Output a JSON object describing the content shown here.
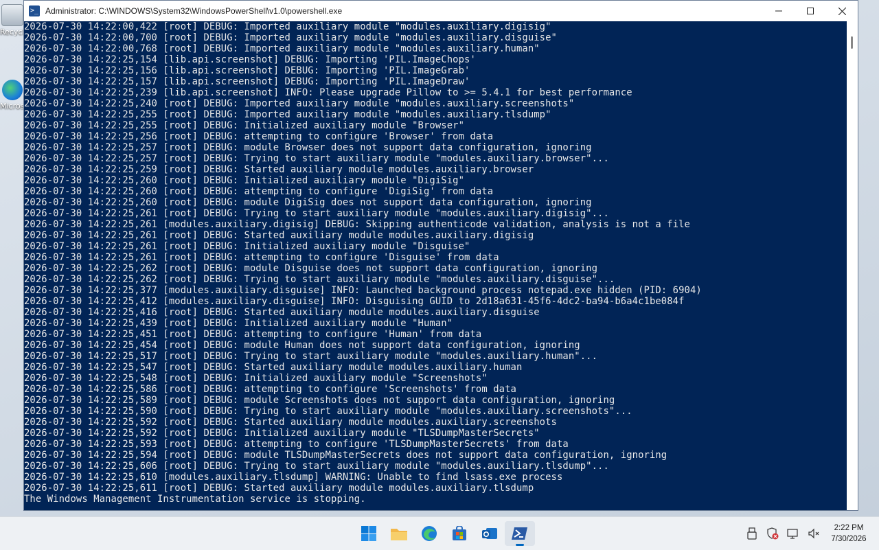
{
  "desktop": {
    "icons": [
      {
        "label": "Recycle Bin"
      },
      {
        "label": "Microsoft Edge"
      }
    ]
  },
  "window": {
    "title": "Administrator: C:\\WINDOWS\\System32\\WindowsPowerShell\\v1.0\\powershell.exe",
    "colors": {
      "console_bg": "#012456",
      "console_fg": "#e8e8e8"
    }
  },
  "console": {
    "lines": [
      "2026-07-30 14:22:00,422 [root] DEBUG: Imported auxiliary module \"modules.auxiliary.digisig\"",
      "2026-07-30 14:22:00,700 [root] DEBUG: Imported auxiliary module \"modules.auxiliary.disguise\"",
      "2026-07-30 14:22:00,768 [root] DEBUG: Imported auxiliary module \"modules.auxiliary.human\"",
      "2026-07-30 14:22:25,154 [lib.api.screenshot] DEBUG: Importing 'PIL.ImageChops'",
      "2026-07-30 14:22:25,156 [lib.api.screenshot] DEBUG: Importing 'PIL.ImageGrab'",
      "2026-07-30 14:22:25,157 [lib.api.screenshot] DEBUG: Importing 'PIL.ImageDraw'",
      "2026-07-30 14:22:25,239 [lib.api.screenshot] INFO: Please upgrade Pillow to >= 5.4.1 for best performance",
      "2026-07-30 14:22:25,240 [root] DEBUG: Imported auxiliary module \"modules.auxiliary.screenshots\"",
      "2026-07-30 14:22:25,255 [root] DEBUG: Imported auxiliary module \"modules.auxiliary.tlsdump\"",
      "2026-07-30 14:22:25,255 [root] DEBUG: Initialized auxiliary module \"Browser\"",
      "2026-07-30 14:22:25,256 [root] DEBUG: attempting to configure 'Browser' from data",
      "2026-07-30 14:22:25,257 [root] DEBUG: module Browser does not support data configuration, ignoring",
      "2026-07-30 14:22:25,257 [root] DEBUG: Trying to start auxiliary module \"modules.auxiliary.browser\"...",
      "2026-07-30 14:22:25,259 [root] DEBUG: Started auxiliary module modules.auxiliary.browser",
      "2026-07-30 14:22:25,260 [root] DEBUG: Initialized auxiliary module \"DigiSig\"",
      "2026-07-30 14:22:25,260 [root] DEBUG: attempting to configure 'DigiSig' from data",
      "2026-07-30 14:22:25,260 [root] DEBUG: module DigiSig does not support data configuration, ignoring",
      "2026-07-30 14:22:25,261 [root] DEBUG: Trying to start auxiliary module \"modules.auxiliary.digisig\"...",
      "2026-07-30 14:22:25,261 [modules.auxiliary.digisig] DEBUG: Skipping authenticode validation, analysis is not a file",
      "2026-07-30 14:22:25,261 [root] DEBUG: Started auxiliary module modules.auxiliary.digisig",
      "2026-07-30 14:22:25,261 [root] DEBUG: Initialized auxiliary module \"Disguise\"",
      "2026-07-30 14:22:25,261 [root] DEBUG: attempting to configure 'Disguise' from data",
      "2026-07-30 14:22:25,262 [root] DEBUG: module Disguise does not support data configuration, ignoring",
      "2026-07-30 14:22:25,262 [root] DEBUG: Trying to start auxiliary module \"modules.auxiliary.disguise\"...",
      "2026-07-30 14:22:25,377 [modules.auxiliary.disguise] INFO: Launched background process notepad.exe hidden (PID: 6904)",
      "2026-07-30 14:22:25,412 [modules.auxiliary.disguise] INFO: Disguising GUID to 2d18a631-45f6-4dc2-ba94-b6a4c1be084f",
      "2026-07-30 14:22:25,416 [root] DEBUG: Started auxiliary module modules.auxiliary.disguise",
      "2026-07-30 14:22:25,439 [root] DEBUG: Initialized auxiliary module \"Human\"",
      "2026-07-30 14:22:25,451 [root] DEBUG: attempting to configure 'Human' from data",
      "2026-07-30 14:22:25,454 [root] DEBUG: module Human does not support data configuration, ignoring",
      "2026-07-30 14:22:25,517 [root] DEBUG: Trying to start auxiliary module \"modules.auxiliary.human\"...",
      "2026-07-30 14:22:25,547 [root] DEBUG: Started auxiliary module modules.auxiliary.human",
      "2026-07-30 14:22:25,548 [root] DEBUG: Initialized auxiliary module \"Screenshots\"",
      "2026-07-30 14:22:25,586 [root] DEBUG: attempting to configure 'Screenshots' from data",
      "2026-07-30 14:22:25,589 [root] DEBUG: module Screenshots does not support data configuration, ignoring",
      "2026-07-30 14:22:25,590 [root] DEBUG: Trying to start auxiliary module \"modules.auxiliary.screenshots\"...",
      "2026-07-30 14:22:25,592 [root] DEBUG: Started auxiliary module modules.auxiliary.screenshots",
      "2026-07-30 14:22:25,592 [root] DEBUG: Initialized auxiliary module \"TLSDumpMasterSecrets\"",
      "2026-07-30 14:22:25,593 [root] DEBUG: attempting to configure 'TLSDumpMasterSecrets' from data",
      "2026-07-30 14:22:25,594 [root] DEBUG: module TLSDumpMasterSecrets does not support data configuration, ignoring",
      "2026-07-30 14:22:25,606 [root] DEBUG: Trying to start auxiliary module \"modules.auxiliary.tlsdump\"...",
      "2026-07-30 14:22:25,610 [modules.auxiliary.tlsdump] WARNING: Unable to find lsass.exe process",
      "2026-07-30 14:22:25,611 [root] DEBUG: Started auxiliary module modules.auxiliary.tlsdump",
      "The Windows Management Instrumentation service is stopping."
    ]
  },
  "taskbar": {
    "apps": [
      {
        "icon": "windows-start-icon"
      },
      {
        "icon": "file-explorer-icon"
      },
      {
        "icon": "edge-icon"
      },
      {
        "icon": "microsoft-store-icon"
      },
      {
        "icon": "outlook-icon"
      },
      {
        "icon": "powershell-icon"
      }
    ],
    "clock": {
      "time": "2:22 PM",
      "date": "7/30/2026"
    }
  }
}
